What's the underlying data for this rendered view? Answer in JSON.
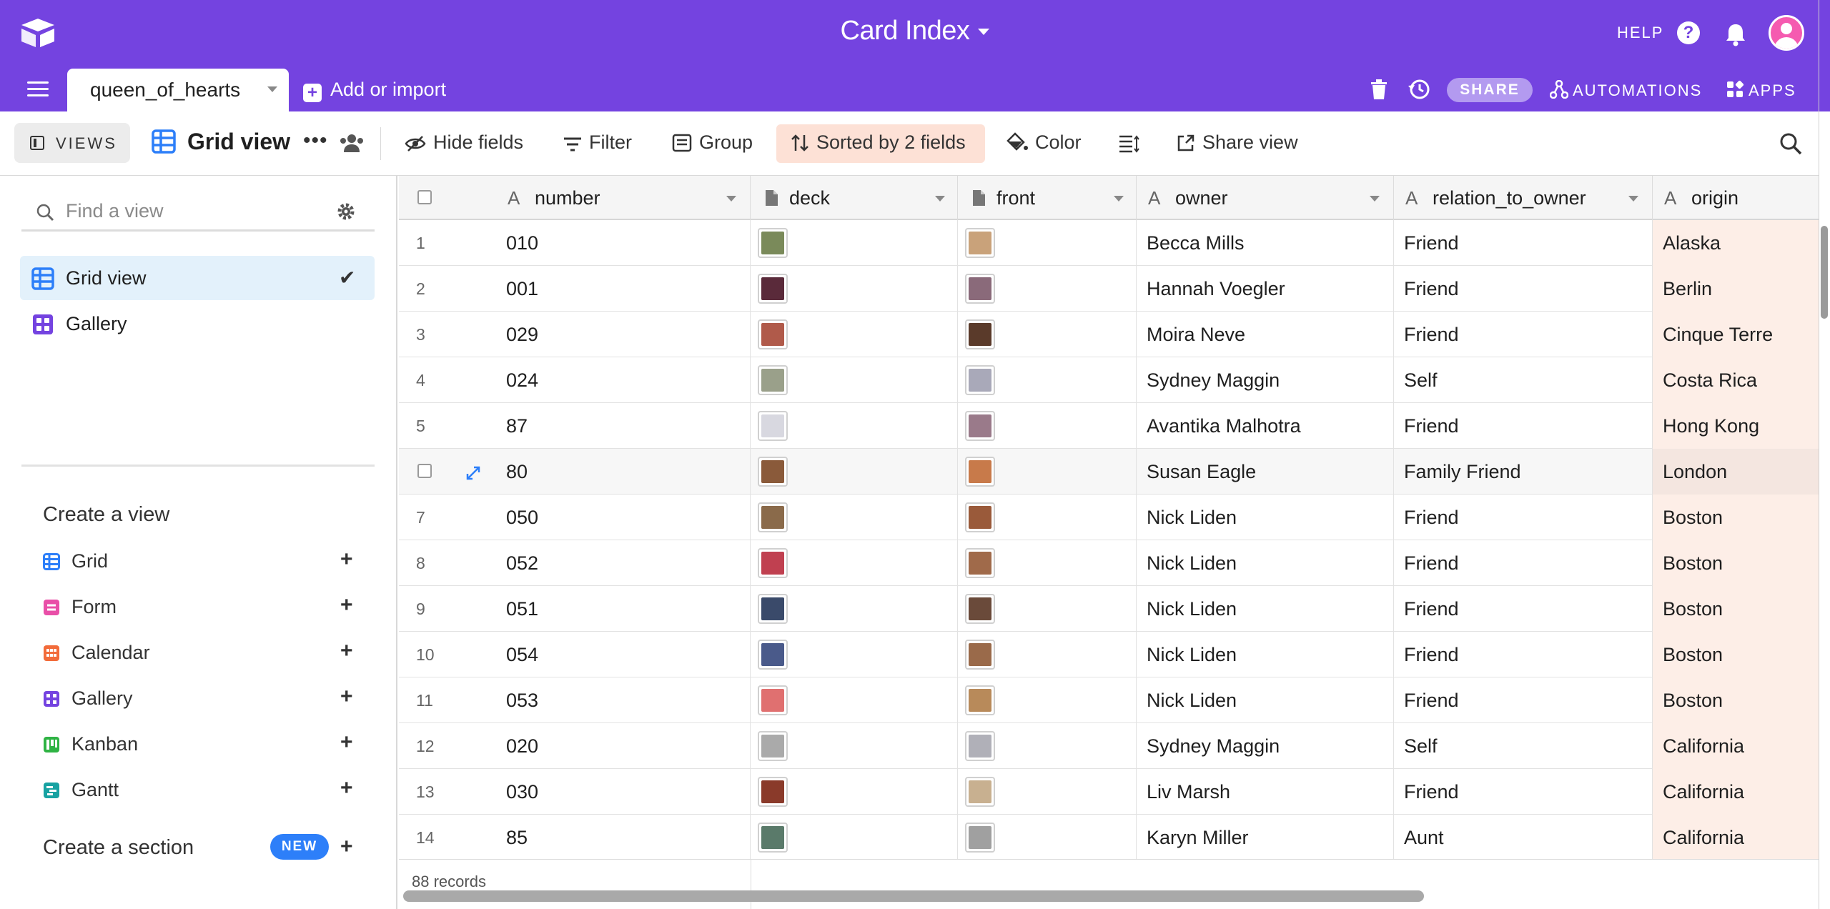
{
  "header": {
    "base_title": "Card Index",
    "help_label": "HELP",
    "share_label": "SHARE",
    "automations_label": "AUTOMATIONS",
    "apps_label": "APPS",
    "brand_color": "#7443e0",
    "table_tab": "queen_of_hearts",
    "add_import_label": "Add or import"
  },
  "viewbar": {
    "views_label": "VIEWS",
    "current_view": "Grid view",
    "hide_fields": "Hide fields",
    "filter": "Filter",
    "group": "Group",
    "sorted": "Sorted by 2 fields",
    "color": "Color",
    "share_view": "Share view"
  },
  "sidebar": {
    "search_placeholder": "Find a view",
    "views": [
      {
        "label": "Grid view",
        "icon": "grid-icon",
        "selected": true
      },
      {
        "label": "Gallery",
        "icon": "gallery-icon",
        "selected": false
      }
    ],
    "create_view_heading": "Create a view",
    "create_items": [
      {
        "label": "Grid",
        "icon": "grid-icon",
        "color": "#2d7ff9"
      },
      {
        "label": "Form",
        "icon": "form-icon",
        "color": "#e94fa8"
      },
      {
        "label": "Calendar",
        "icon": "calendar-icon",
        "color": "#f26b3a"
      },
      {
        "label": "Gallery",
        "icon": "gallery-icon",
        "color": "#7443e0"
      },
      {
        "label": "Kanban",
        "icon": "kanban-icon",
        "color": "#2fb344"
      },
      {
        "label": "Gantt",
        "icon": "gantt-icon",
        "color": "#17a2a2"
      }
    ],
    "create_section_heading": "Create a section",
    "new_badge": "NEW"
  },
  "grid": {
    "columns": [
      {
        "name": "number",
        "type_icon": "text-icon"
      },
      {
        "name": "deck",
        "type_icon": "attachment-icon"
      },
      {
        "name": "front",
        "type_icon": "attachment-icon"
      },
      {
        "name": "owner",
        "type_icon": "text-icon"
      },
      {
        "name": "relation_to_owner",
        "type_icon": "text-icon"
      },
      {
        "name": "origin",
        "type_icon": "text-icon"
      }
    ],
    "rows": [
      {
        "rownum": "1",
        "number": "010",
        "owner": "Becca Mills",
        "relation": "Friend",
        "origin": "Alaska",
        "deck_color": "#7a8a5a",
        "front_color": "#c9a27a"
      },
      {
        "rownum": "2",
        "number": "001",
        "owner": "Hannah Voegler",
        "relation": "Friend",
        "origin": "Berlin",
        "deck_color": "#5a2a3a",
        "front_color": "#8a6a7a"
      },
      {
        "rownum": "3",
        "number": "029",
        "owner": "Moira Neve",
        "relation": "Friend",
        "origin": "Cinque Terre",
        "deck_color": "#b05a4a",
        "front_color": "#5a3a2a"
      },
      {
        "rownum": "4",
        "number": "024",
        "owner": "Sydney Maggin",
        "relation": "Self",
        "origin": "Costa Rica",
        "deck_color": "#9aa08a",
        "front_color": "#a9a9b9"
      },
      {
        "rownum": "5",
        "number": "87",
        "owner": "Avantika Malhotra",
        "relation": "Friend",
        "origin": "Hong Kong",
        "deck_color": "#d8d8e0",
        "front_color": "#9a7a8a"
      },
      {
        "rownum": "",
        "number": "80",
        "owner": "Susan Eagle",
        "relation": "Family Friend",
        "origin": "London",
        "deck_color": "#8a5a3a",
        "front_color": "#c87a4a"
      },
      {
        "rownum": "7",
        "number": "050",
        "owner": "Nick Liden",
        "relation": "Friend",
        "origin": "Boston",
        "deck_color": "#8a6a4a",
        "front_color": "#9a5a3a"
      },
      {
        "rownum": "8",
        "number": "052",
        "owner": "Nick Liden",
        "relation": "Friend",
        "origin": "Boston",
        "deck_color": "#c04050",
        "front_color": "#a06a4a"
      },
      {
        "rownum": "9",
        "number": "051",
        "owner": "Nick Liden",
        "relation": "Friend",
        "origin": "Boston",
        "deck_color": "#3a4a6a",
        "front_color": "#6a4a3a"
      },
      {
        "rownum": "10",
        "number": "054",
        "owner": "Nick Liden",
        "relation": "Friend",
        "origin": "Boston",
        "deck_color": "#4a5a8a",
        "front_color": "#9a6a4a"
      },
      {
        "rownum": "11",
        "number": "053",
        "owner": "Nick Liden",
        "relation": "Friend",
        "origin": "Boston",
        "deck_color": "#e07070",
        "front_color": "#b88a5a"
      },
      {
        "rownum": "12",
        "number": "020",
        "owner": "Sydney Maggin",
        "relation": "Self",
        "origin": "California",
        "deck_color": "#aaaaaa",
        "front_color": "#b0b0b8"
      },
      {
        "rownum": "13",
        "number": "030",
        "owner": "Liv Marsh",
        "relation": "Friend",
        "origin": "California",
        "deck_color": "#8a3a2a",
        "front_color": "#c8b090"
      },
      {
        "rownum": "14",
        "number": "85",
        "owner": "Karyn Miller",
        "relation": "Aunt",
        "origin": "California",
        "deck_color": "#5a7a6a",
        "front_color": "#a0a0a0"
      }
    ],
    "record_count": "88 records"
  }
}
